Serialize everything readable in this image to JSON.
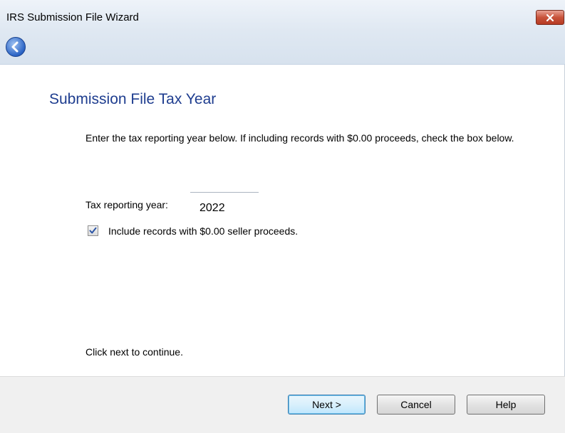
{
  "window": {
    "title": "IRS Submission File Wizard",
    "close_glyph": "x"
  },
  "nav": {
    "back_icon": "back-arrow-icon"
  },
  "page": {
    "title": "Submission File Tax Year",
    "instructions": "Enter the tax reporting year below.  If including records with $0.00 proceeds, check the box below.",
    "year_label": "Tax reporting year:",
    "year_value": "2022",
    "include_zero_label": "Include records with $0.00 seller proceeds.",
    "include_zero_checked": true,
    "continue_text": "Click next to continue."
  },
  "buttons": {
    "next": "Next >",
    "cancel": "Cancel",
    "help": "Help"
  },
  "colors": {
    "title_blue": "#1e3d8f",
    "close_red": "#c8533b",
    "back_blue": "#2a63c4"
  }
}
